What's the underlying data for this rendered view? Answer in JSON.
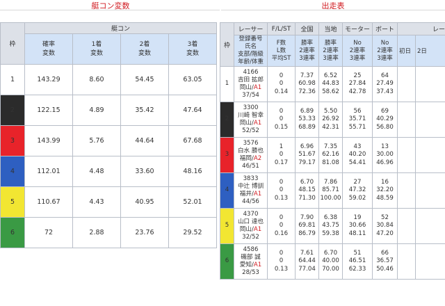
{
  "titles": {
    "left": "艇コン変数",
    "right": "出走表"
  },
  "left_table": {
    "group_header": "艇コン",
    "waku_header": "枠",
    "columns": [
      [
        "確率",
        "変数"
      ],
      [
        "1着",
        "変数"
      ],
      [
        "2着",
        "変数"
      ],
      [
        "3着",
        "変数"
      ]
    ],
    "rows": [
      {
        "waku": "1",
        "v": [
          "143.29",
          "8.60",
          "54.45",
          "63.05"
        ]
      },
      {
        "waku": "2",
        "v": [
          "122.15",
          "4.89",
          "35.42",
          "47.64"
        ]
      },
      {
        "waku": "3",
        "v": [
          "143.99",
          "5.76",
          "44.64",
          "67.68"
        ]
      },
      {
        "waku": "4",
        "v": [
          "112.01",
          "4.48",
          "33.60",
          "48.16"
        ]
      },
      {
        "waku": "5",
        "v": [
          "110.67",
          "4.43",
          "40.95",
          "52.01"
        ]
      },
      {
        "waku": "6",
        "v": [
          "72",
          "2.88",
          "23.76",
          "29.52"
        ]
      }
    ]
  },
  "right_table": {
    "waku_header": "枠",
    "group_headers": [
      "レーサー",
      "F/L/ST",
      "全国",
      "当地",
      "モーター",
      "ボート",
      "レー"
    ],
    "sub_headers": {
      "racer": [
        "登録番号",
        "氏名",
        "支部/階級",
        "年齢/体重"
      ],
      "fls": [
        "F数",
        "L数",
        "平均ST"
      ],
      "national": [
        "勝率",
        "2連率",
        "3連率"
      ],
      "local": [
        "勝率",
        "2連率",
        "3連率"
      ],
      "motor": [
        "No",
        "2連率",
        "3連率"
      ],
      "boat": [
        "No",
        "2連率",
        "3連率"
      ],
      "race_days": [
        "初日",
        "2日"
      ]
    },
    "rows": [
      {
        "waku": "1",
        "id": "4166",
        "name": "吉田 拡郎",
        "branch": "岡山",
        "cls": "A1",
        "age": "37/54",
        "fls": [
          "0",
          "0",
          "0.14"
        ],
        "national": [
          "7.37",
          "60.98",
          "72.36"
        ],
        "local": [
          "6.52",
          "44.83",
          "58.62"
        ],
        "motor": [
          "25",
          "27.84",
          "42.78"
        ],
        "boat": [
          "64",
          "27.49",
          "37.43"
        ]
      },
      {
        "waku": "2",
        "id": "3300",
        "name": "川崎 智幸",
        "branch": "岡山",
        "cls": "A1",
        "age": "52/52",
        "fls": [
          "0",
          "0",
          "0.15"
        ],
        "national": [
          "6.89",
          "53.33",
          "68.89"
        ],
        "local": [
          "5.50",
          "26.92",
          "42.31"
        ],
        "motor": [
          "56",
          "35.71",
          "55.71"
        ],
        "boat": [
          "69",
          "40.29",
          "56.80"
        ]
      },
      {
        "waku": "3",
        "id": "3576",
        "name": "白水 勝也",
        "branch": "福岡",
        "cls": "A2",
        "age": "46/51",
        "fls": [
          "1",
          "0",
          "0.17"
        ],
        "national": [
          "6.96",
          "51.67",
          "79.17"
        ],
        "local": [
          "7.35",
          "62.16",
          "81.08"
        ],
        "motor": [
          "43",
          "40.20",
          "54.41"
        ],
        "boat": [
          "13",
          "30.00",
          "46.96"
        ]
      },
      {
        "waku": "4",
        "id": "3833",
        "name": "中辻 博訓",
        "branch": "福井",
        "cls": "A1",
        "age": "44/56",
        "fls": [
          "0",
          "0",
          "0.13"
        ],
        "national": [
          "6.70",
          "48.15",
          "71.30"
        ],
        "local": [
          "7.86",
          "85.71",
          "100.00"
        ],
        "motor": [
          "27",
          "47.32",
          "59.02"
        ],
        "boat": [
          "16",
          "32.20",
          "48.59"
        ]
      },
      {
        "waku": "5",
        "id": "4370",
        "name": "山口 達也",
        "branch": "岡山",
        "cls": "A1",
        "age": "32/52",
        "fls": [
          "0",
          "0",
          "0.16"
        ],
        "national": [
          "7.90",
          "69.81",
          "86.79"
        ],
        "local": [
          "6.38",
          "43.75",
          "59.38"
        ],
        "motor": [
          "19",
          "30.66",
          "48.11"
        ],
        "boat": [
          "52",
          "30.84",
          "47.20"
        ]
      },
      {
        "waku": "6",
        "id": "4586",
        "name": "磯部 誠",
        "branch": "愛知",
        "cls": "A1",
        "age": "28/53",
        "fls": [
          "0",
          "0",
          "0.13"
        ],
        "national": [
          "7.61",
          "64.44",
          "77.04"
        ],
        "local": [
          "6.70",
          "40.00",
          "70.00"
        ],
        "motor": [
          "51",
          "46.51",
          "62.33"
        ],
        "boat": [
          "66",
          "36.57",
          "50.46"
        ]
      }
    ]
  },
  "colors": {
    "title_red": "#d0191f",
    "header_grey": "#dde1e8",
    "header_blue": "#d3e3f7",
    "waku1": "#ffffff",
    "waku2": "#2b2b2b",
    "waku3": "#e8232a",
    "waku4": "#2e5fc1",
    "waku5": "#f2e632",
    "waku6": "#3a9a44"
  }
}
